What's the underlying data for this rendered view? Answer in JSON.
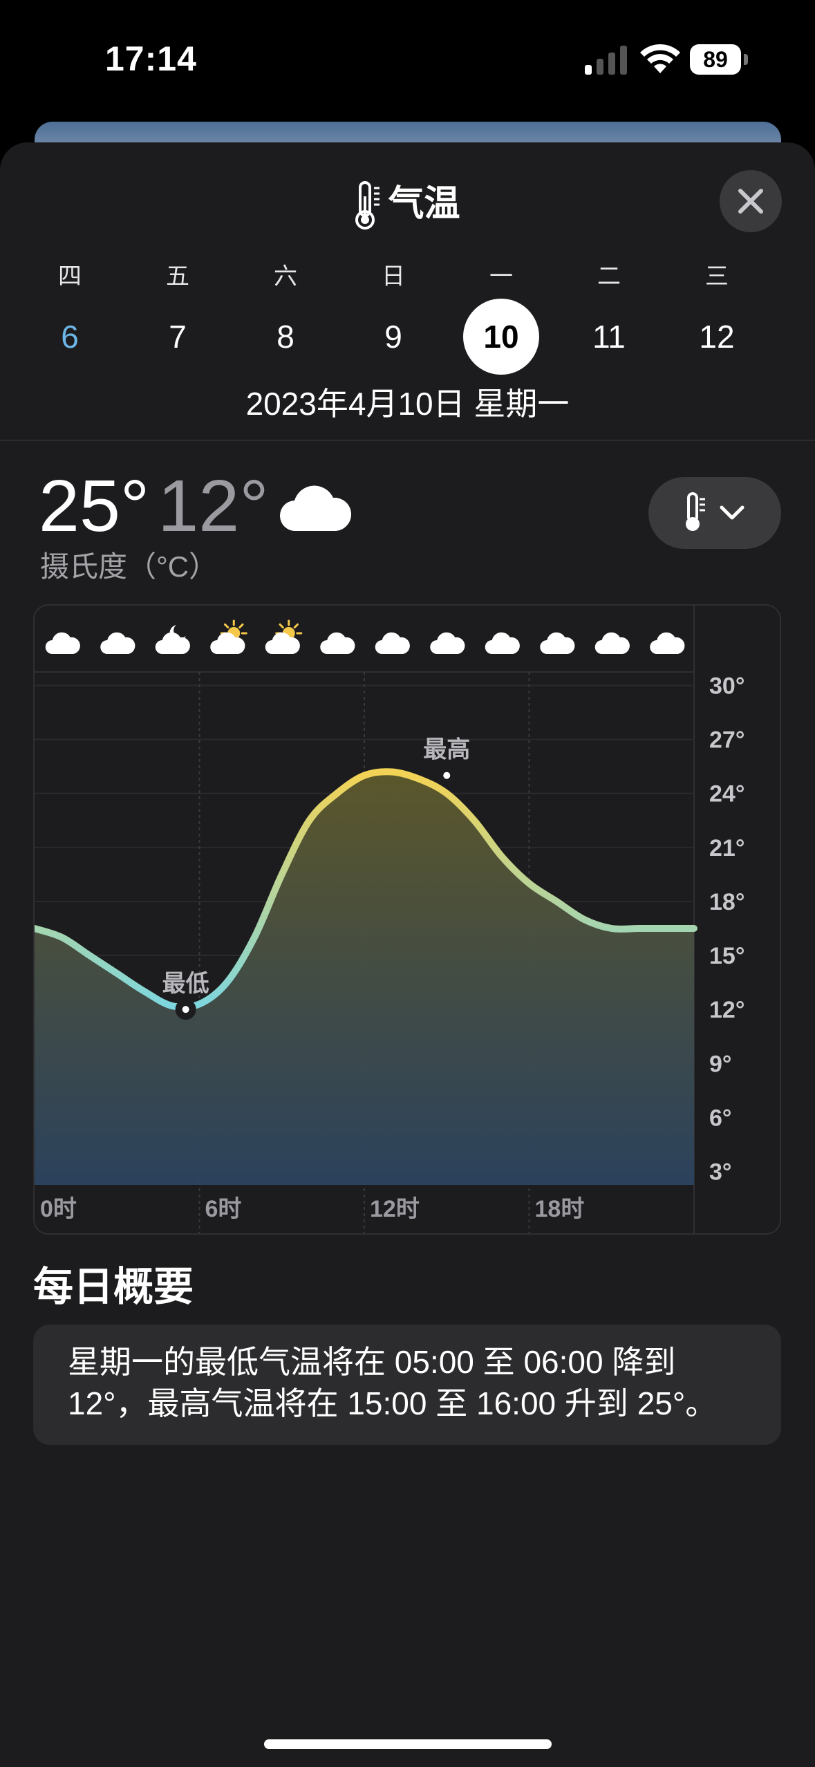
{
  "status_bar": {
    "time": "17:14",
    "battery": "89"
  },
  "sheet": {
    "title": "气温",
    "close_icon": "xmark-icon",
    "weekdays": [
      "四",
      "五",
      "六",
      "日",
      "一",
      "二",
      "三"
    ],
    "dates": [
      "6",
      "7",
      "8",
      "9",
      "10",
      "11",
      "12"
    ],
    "selected_date": "10",
    "full_date": "2023年4月10日 星期一"
  },
  "overview": {
    "high": "25°",
    "low": "12°",
    "condition_icon": "cloud-icon",
    "unit": "摄氏度（°C）",
    "toggle_icon": "thermometer-icon"
  },
  "chart_data": {
    "type": "area",
    "x": [
      0,
      1,
      2,
      3,
      4,
      5,
      6,
      7,
      8,
      9,
      10,
      11,
      12,
      13,
      14,
      15,
      16,
      17,
      18,
      19,
      20,
      21,
      22,
      23,
      24
    ],
    "values": [
      16.5,
      16,
      15,
      14,
      13,
      12.2,
      12.3,
      13.5,
      16,
      19.5,
      22.5,
      24,
      25,
      25.2,
      24.8,
      24,
      22.5,
      20.5,
      19,
      18,
      17,
      16.5,
      16.5,
      16.5,
      16.5
    ],
    "ylim": [
      3,
      30
    ],
    "y_ticks": [
      "30°",
      "27°",
      "24°",
      "21°",
      "18°",
      "15°",
      "12°",
      "9°",
      "6°",
      "3°"
    ],
    "x_ticks": [
      "0时",
      "6时",
      "12时",
      "18时"
    ],
    "hourly_icons": [
      "cloud",
      "cloud",
      "cloud-moon",
      "cloud-sun",
      "cloud-sun",
      "cloud",
      "cloud",
      "cloud",
      "cloud",
      "cloud",
      "cloud",
      "cloud"
    ],
    "annotations": [
      {
        "label": "最低",
        "x": 5.5,
        "y": 12
      },
      {
        "label": "最高",
        "x": 15,
        "y": 25
      }
    ],
    "grid": true,
    "colors": {
      "low": "#7cd6e0",
      "high": "#f2d356",
      "fill_top": "#5e5a2c",
      "fill_bottom": "#2c4460"
    }
  },
  "summary": {
    "heading": "每日概要",
    "text": "星期一的最低气温将在 05:00 至 06:00 降到 12°，最高气温将在 15:00 至 16:00 升到 25°。"
  }
}
